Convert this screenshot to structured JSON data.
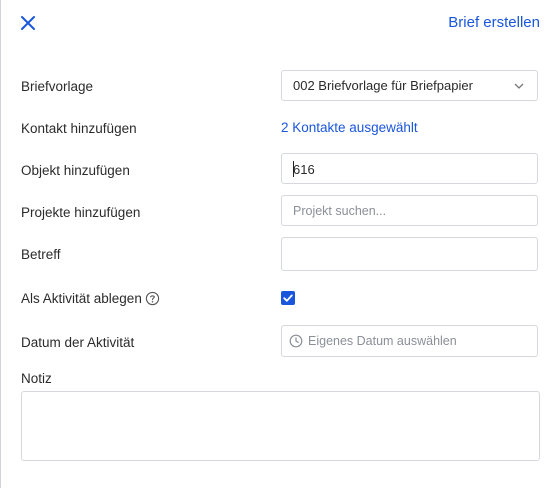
{
  "header": {
    "close_icon": "close-icon",
    "action_label": "Brief erstellen",
    "accent_color": "#1a56db"
  },
  "form": {
    "template": {
      "label": "Briefvorlage",
      "selected": "002 Briefvorlage für Briefpapier"
    },
    "contact": {
      "label": "Kontakt hinzufügen",
      "value": "2 Kontakte ausgewählt"
    },
    "object": {
      "label": "Objekt hinzufügen",
      "value": "616"
    },
    "projects": {
      "label": "Projekte hinzufügen",
      "placeholder": "Projekt suchen..."
    },
    "subject": {
      "label": "Betreff",
      "value": ""
    },
    "activity": {
      "label": "Als Aktivität ablegen",
      "checked": true,
      "help_icon": "question-circle-icon"
    },
    "date": {
      "label": "Datum der Aktivität",
      "placeholder": "Eigenes Datum auswählen",
      "icon": "clock-icon"
    },
    "note": {
      "label": "Notiz",
      "value": ""
    }
  }
}
